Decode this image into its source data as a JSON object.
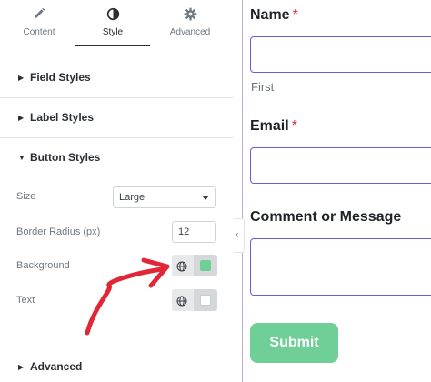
{
  "tabs": [
    {
      "label": "Content",
      "icon": "pencil-icon"
    },
    {
      "label": "Style",
      "icon": "contrast-icon",
      "active": true
    },
    {
      "label": "Advanced",
      "icon": "gear-icon"
    }
  ],
  "sections": {
    "field_styles": "Field Styles",
    "label_styles": "Label Styles",
    "button_styles": "Button Styles",
    "advanced": "Advanced"
  },
  "button_styles": {
    "size_label": "Size",
    "size_value": "Large",
    "radius_label": "Border Radius (px)",
    "radius_value": "12",
    "background_label": "Background",
    "background_color": "#6fcf97",
    "text_label": "Text",
    "text_color": "#ffffff"
  },
  "form": {
    "name_label": "Name",
    "name_required": "*",
    "first_sublabel": "First",
    "email_label": "Email",
    "email_required": "*",
    "comment_label": "Comment or Message",
    "submit_label": "Submit"
  },
  "colors": {
    "accent_input_border": "#6b5cd6",
    "required": "#d4303a",
    "annotation_arrow": "#e32636"
  }
}
